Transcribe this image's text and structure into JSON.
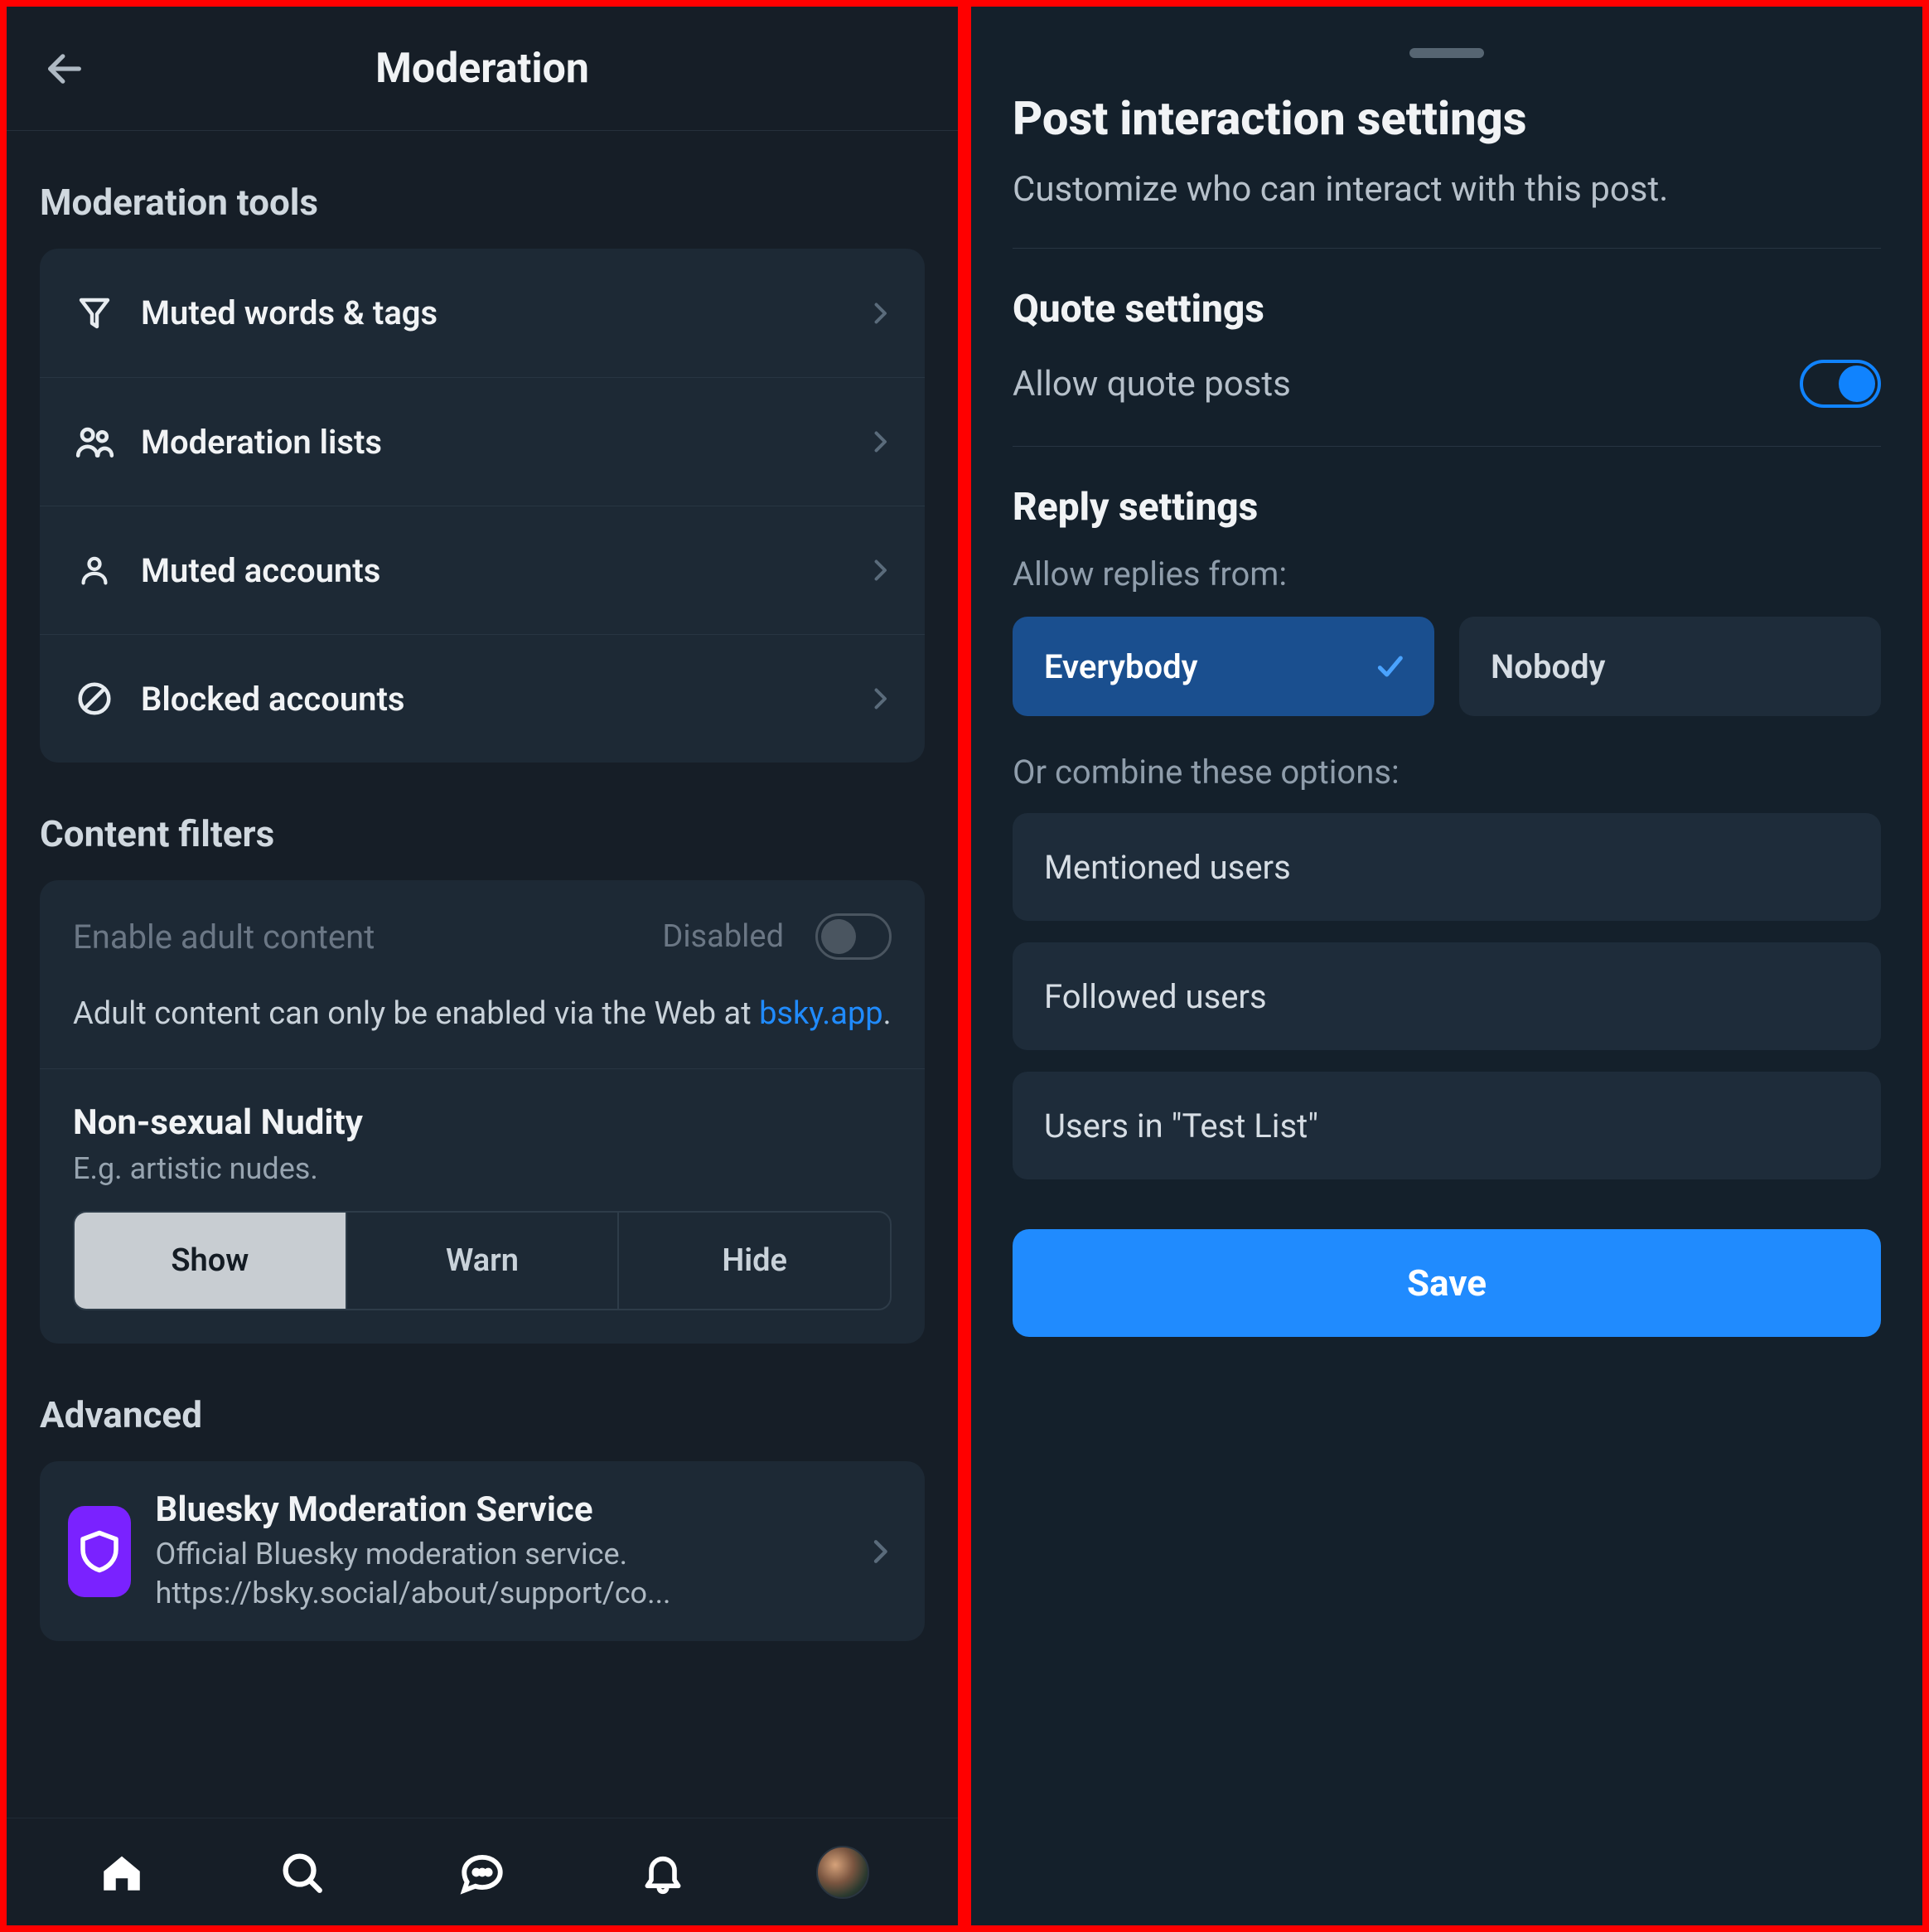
{
  "left": {
    "header_title": "Moderation",
    "tools_title": "Moderation tools",
    "tools": [
      {
        "icon": "filter-icon",
        "label": "Muted words & tags"
      },
      {
        "icon": "users-icon",
        "label": "Moderation lists"
      },
      {
        "icon": "person-icon",
        "label": "Muted accounts"
      },
      {
        "icon": "block-icon",
        "label": "Blocked accounts"
      }
    ],
    "filters_title": "Content filters",
    "adult": {
      "label": "Enable adult content",
      "state": "Disabled",
      "note_prefix": "Adult content can only be enabled via the Web at ",
      "note_link": "bsky.app",
      "note_suffix": "."
    },
    "nudity": {
      "title": "Non-sexual Nudity",
      "subtitle": "E.g. artistic nudes.",
      "options": [
        "Show",
        "Warn",
        "Hide"
      ],
      "selected": "Show"
    },
    "advanced_title": "Advanced",
    "service": {
      "title": "Bluesky Moderation Service",
      "desc": "Official Bluesky moderation service. https://bsky.social/about/support/co..."
    }
  },
  "right": {
    "title": "Post interaction settings",
    "subtitle": "Customize who can interact with this post.",
    "quote": {
      "heading": "Quote settings",
      "label": "Allow quote posts",
      "enabled": true
    },
    "reply": {
      "heading": "Reply settings",
      "from_label": "Allow replies from:",
      "options": [
        "Everybody",
        "Nobody"
      ],
      "selected": "Everybody",
      "combine_label": "Or combine these options:",
      "combine_options": [
        "Mentioned users",
        "Followed users",
        "Users in \"Test List\""
      ]
    },
    "save_label": "Save"
  }
}
